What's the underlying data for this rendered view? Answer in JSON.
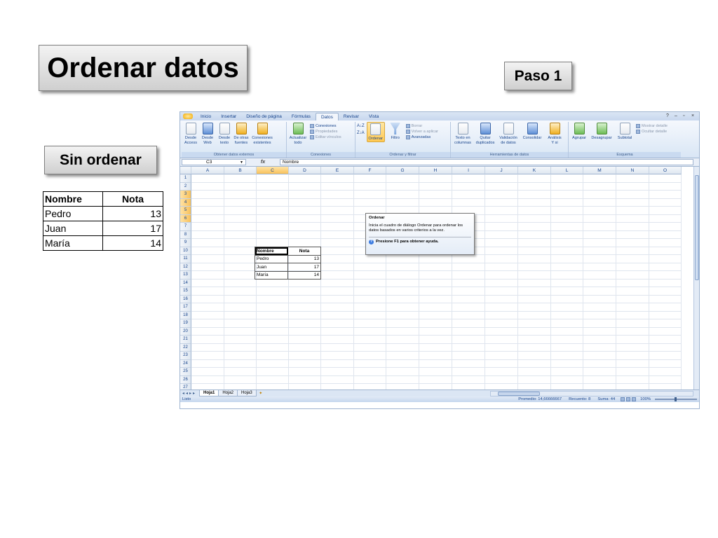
{
  "slide": {
    "title": "Ordenar datos",
    "step": "Paso 1",
    "unsorted_label": "Sin ordenar",
    "table": {
      "headers": [
        "Nombre",
        "Nota"
      ],
      "rows": [
        [
          "Pedro",
          "13"
        ],
        [
          "Juan",
          "17"
        ],
        [
          "María",
          "14"
        ]
      ]
    }
  },
  "excel": {
    "tabs": [
      "Inicio",
      "Insertar",
      "Diseño de página",
      "Fórmulas",
      "Datos",
      "Revisar",
      "Vista"
    ],
    "active_tab": "Datos",
    "groups": {
      "external": {
        "label": "Obtener datos externos",
        "buttons": [
          [
            "Desde",
            "Access"
          ],
          [
            "Desde",
            "Web"
          ],
          [
            "Desde",
            "texto"
          ],
          [
            "De otras",
            "fuentes"
          ],
          [
            "Conexiones",
            "existentes"
          ]
        ]
      },
      "connections": {
        "label": "Conexiones",
        "refresh": [
          "Actualizar",
          "todo"
        ],
        "items": [
          "Conexiones",
          "Propiedades",
          "Editar vínculos"
        ]
      },
      "sort_filter": {
        "label": "Ordenar y filtrar",
        "sort": "Ordenar",
        "filter": "Filtro",
        "items": [
          "Borrar",
          "Volver a aplicar",
          "Avanzadas"
        ]
      },
      "data_tools": {
        "label": "Herramientas de datos",
        "buttons": [
          [
            "Texto en",
            "columnas"
          ],
          [
            "Quitar",
            "duplicados"
          ],
          [
            "Validación",
            "de datos"
          ],
          [
            "Consolidar",
            ""
          ],
          [
            "Análisis",
            "Y si"
          ]
        ]
      },
      "outline": {
        "label": "Esquema",
        "buttons": [
          "Agrupar",
          "Desagrupar",
          "Subtotal"
        ],
        "items": [
          "Mostrar detalle",
          "Ocultar detalle"
        ]
      }
    },
    "name_box": "C3",
    "fx": "fx",
    "formula_value": "Nombre",
    "columns": [
      "A",
      "B",
      "C",
      "D",
      "E",
      "F",
      "G",
      "H",
      "I",
      "J",
      "K",
      "L",
      "M",
      "N",
      "O"
    ],
    "rows": [
      "1",
      "2",
      "3",
      "4",
      "5",
      "6",
      "7",
      "8",
      "9",
      "10",
      "11",
      "12",
      "13",
      "14",
      "15",
      "16",
      "17",
      "18",
      "19",
      "20",
      "21",
      "22",
      "23",
      "24",
      "25",
      "26",
      "27"
    ],
    "sheet_table": {
      "headers": [
        "Nombre",
        "Nota"
      ],
      "rows": [
        [
          "Pedro",
          "13"
        ],
        [
          "Juan",
          "17"
        ],
        [
          "María",
          "14"
        ]
      ]
    },
    "tooltip": {
      "title": "Ordenar",
      "body": "Inicia el cuadro de diálogo Ordenar para ordenar los datos basados en varios criterios a la vez.",
      "help": "Presione F1 para obtener ayuda."
    },
    "sheet_tabs": [
      "Hoja1",
      "Hoja2",
      "Hoja3"
    ],
    "status": {
      "mode": "Listo",
      "average": "Promedio: 14,66666667",
      "count": "Recuento: 8",
      "sum": "Suma: 44",
      "zoom": "100%"
    }
  }
}
